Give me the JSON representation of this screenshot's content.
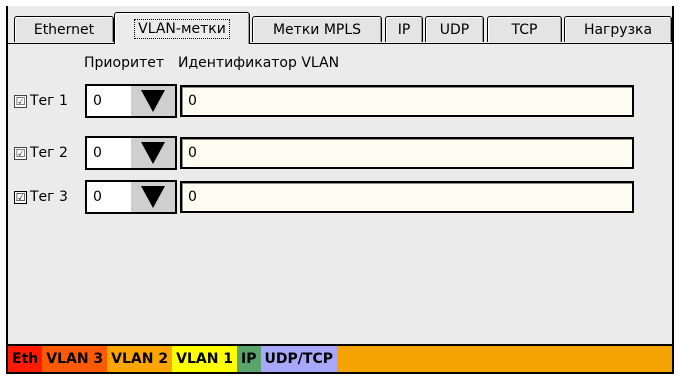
{
  "tabs": [
    {
      "label": "Ethernet",
      "active": false
    },
    {
      "label": "VLAN-метки",
      "active": true
    },
    {
      "label": "Метки MPLS",
      "active": false
    },
    {
      "label": "IP",
      "active": false
    },
    {
      "label": "UDP",
      "active": false
    },
    {
      "label": "TCP",
      "active": false
    },
    {
      "label": "Нагрузка",
      "active": false
    }
  ],
  "headers": {
    "priority": "Приоритет",
    "vlan_id": "Идентификатор VLAN"
  },
  "rows": [
    {
      "checkbox": "☑",
      "label": "Тег 1",
      "priority": "0",
      "vlan_id": "0"
    },
    {
      "checkbox": "☑",
      "label": "Тег 2",
      "priority": "0",
      "vlan_id": "0"
    },
    {
      "checkbox": "☑",
      "label": "Тег 3",
      "priority": "0",
      "vlan_id": "0"
    }
  ],
  "footer": {
    "segments": [
      {
        "label": "Eth",
        "color": "#ff1a00"
      },
      {
        "label": "VLAN 3",
        "color": "#ff5a00"
      },
      {
        "label": "VLAN 2",
        "color": "#ffa500"
      },
      {
        "label": "VLAN 1",
        "color": "#ffff00"
      },
      {
        "label": "IP",
        "color": "#5aa36a"
      },
      {
        "label": "UDP/TCP",
        "color": "#a8a8ff"
      }
    ],
    "fill_color": "#f5a300"
  }
}
